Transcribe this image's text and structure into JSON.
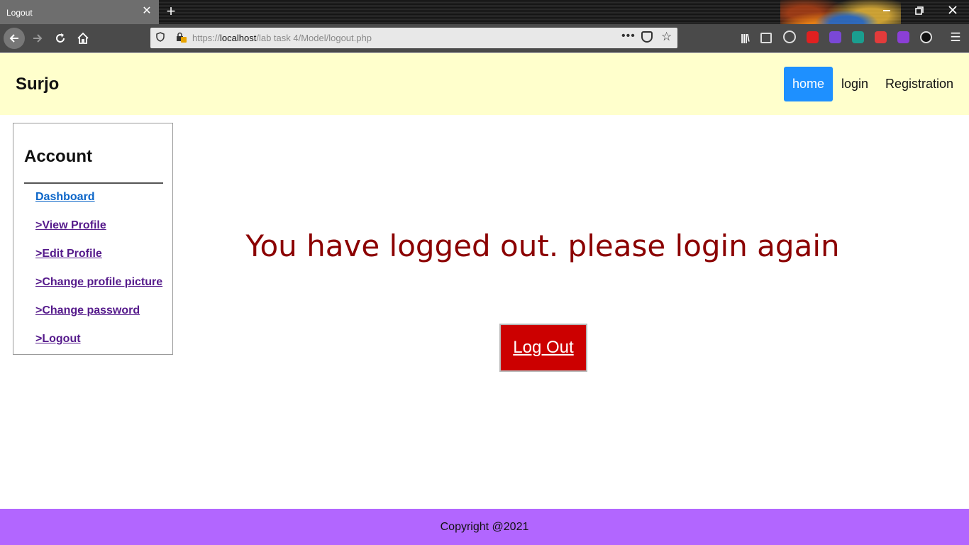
{
  "browser": {
    "tab_title": "Logout",
    "tab_close_glyph": "✕",
    "new_tab_glyph": "+",
    "url_prefix": "https://",
    "url_host": "localhost",
    "url_path": "/lab task 4/Model/logout.php",
    "url_more_glyph": "•••",
    "icons": [
      "back-arrow-icon",
      "forward-arrow-icon",
      "reload-icon",
      "home-icon",
      "shield-icon",
      "lock-warning-icon",
      "pocket-icon",
      "star-icon",
      "library-icon",
      "sidebar-icon",
      "account-icon",
      "menu-icon"
    ],
    "extension_colors": [
      "#e02020",
      "#7a48d6",
      "#1a9e8f",
      "#e23b3b",
      "#8b3fd6",
      "#111111"
    ]
  },
  "header": {
    "brand": "Surjo",
    "nav": [
      {
        "label": "home",
        "active": true
      },
      {
        "label": "login",
        "active": false
      },
      {
        "label": "Registration",
        "active": false
      }
    ]
  },
  "sidebar": {
    "title": "Account",
    "links": [
      {
        "label": "Dashboard"
      },
      {
        "label": ">View Profile"
      },
      {
        "label": ">Edit Profile"
      },
      {
        "label": ">Change profile picture"
      },
      {
        "label": ">Change password"
      },
      {
        "label": ">Logout"
      }
    ]
  },
  "main": {
    "message": "You have logged out. please login again",
    "button_label": "Log Out"
  },
  "footer": {
    "text": "Copyright @2021"
  },
  "colors": {
    "header_bg": "#ffffcc",
    "nav_active_bg": "#1e90ff",
    "message_color": "#8b0000",
    "button_bg": "#cc0000",
    "footer_bg": "#b266ff"
  }
}
